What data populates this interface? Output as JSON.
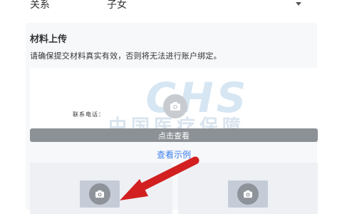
{
  "relation": {
    "label": "关系",
    "value": "子女"
  },
  "materials": {
    "title": "材料上传",
    "description": "请确保提交材料真实有效，否则将无法进行账户绑定。",
    "watermark": "中国医疗保障",
    "watermark_logo": "CHS",
    "phone_label": "联系电话：",
    "view_button": "点击查看",
    "view_example": "查看示例"
  },
  "colors": {
    "link": "#3d7ff0",
    "annotation_arrow": "#d21f1f",
    "watermark": "#d9e4ee"
  }
}
